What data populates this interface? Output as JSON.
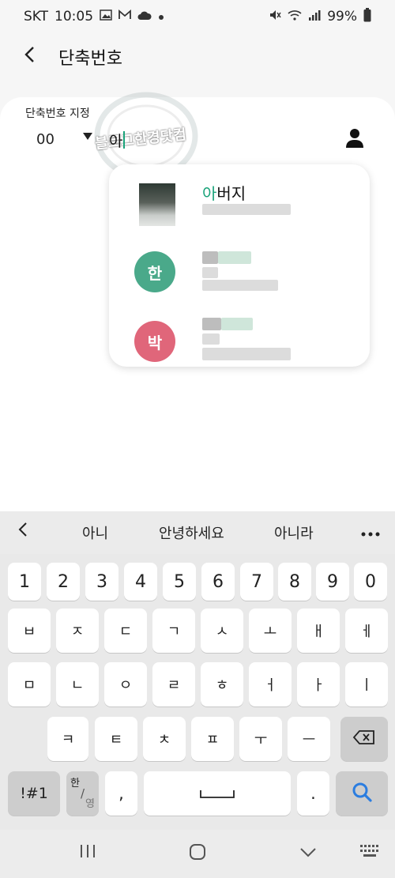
{
  "status_bar": {
    "carrier": "SKT",
    "time": "10:05",
    "battery": "99%"
  },
  "header": {
    "back_icon": "back-arrow-icon",
    "title": "단축번호"
  },
  "form": {
    "label": "단축번호 지정",
    "speed_number": "00",
    "name_value": "아",
    "contact_icon": "contact-person-icon"
  },
  "watermark": {
    "text": "블로그한경닷컴"
  },
  "suggestions": [
    {
      "name_highlight": "아",
      "name_rest": "버지",
      "avatar_letter": "",
      "avatar_type": "photo"
    },
    {
      "name_highlight": "",
      "name_rest": "",
      "avatar_letter": "한",
      "avatar_type": "letter",
      "avatar_color": "#4aa98a"
    },
    {
      "name_highlight": "",
      "name_rest": "",
      "avatar_letter": "박",
      "avatar_type": "letter",
      "avatar_color": "#e0667a"
    }
  ],
  "keyboard": {
    "predictions": [
      "아니",
      "안녕하세요",
      "아니라"
    ],
    "number_row": [
      "1",
      "2",
      "3",
      "4",
      "5",
      "6",
      "7",
      "8",
      "9",
      "0"
    ],
    "row1": [
      "ㅂ",
      "ㅈ",
      "ㄷ",
      "ㄱ",
      "ㅅ",
      "ㅗ",
      "ㅐ",
      "ㅔ"
    ],
    "row2": [
      "ㅁ",
      "ㄴ",
      "ㅇ",
      "ㄹ",
      "ㅎ",
      "ㅓ",
      "ㅏ",
      "ㅣ"
    ],
    "row3": [
      "ㅋ",
      "ㅌ",
      "ㅊ",
      "ㅍ",
      "ㅜ",
      "ㅡ"
    ],
    "symbols_key": "!#1",
    "lang_key_top": "한",
    "lang_key_bottom": "영",
    "comma_key": ",",
    "period_key": ".",
    "space_key": "space-bar-icon",
    "backspace_icon": "backspace-icon",
    "search_icon": "search-icon"
  },
  "colors": {
    "accent": "#1aa37a",
    "search": "#2b7de0"
  }
}
